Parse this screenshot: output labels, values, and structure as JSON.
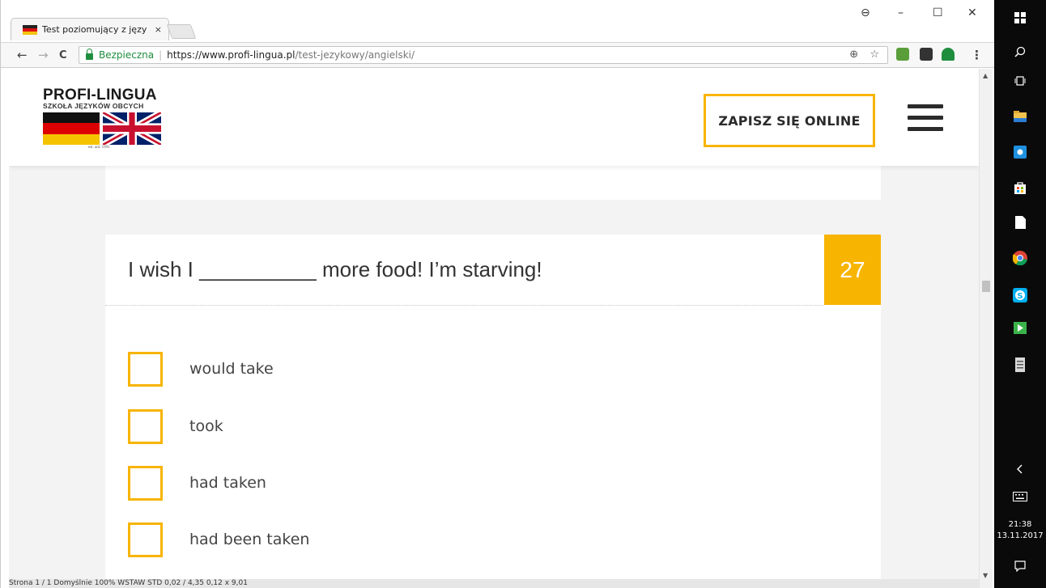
{
  "browser": {
    "tab_title": "Test poziomujący z języka",
    "tab_close": "×",
    "window_controls": {
      "account": "⊖",
      "minimize": "–",
      "maximize": "☐",
      "close": "✕"
    },
    "nav": {
      "back": "←",
      "forward": "→",
      "reload": "C"
    },
    "address": {
      "secure_label": "Bezpieczna",
      "url_scheme_host": "https://www.profi-lingua.pl",
      "url_path": "/test-jezykowy/angielski/"
    },
    "omnibox_icons": {
      "zoom": "⊕",
      "bookmark": "☆"
    },
    "menu": "⋮"
  },
  "site": {
    "logo_name": "PROFI-LINGUA",
    "logo_sub": "SZKOŁA JĘZYKÓW OBCYCH",
    "logo_est": "est. ant. 1991",
    "cta_label": "ZAPISZ SIĘ ONLINE",
    "brand_color": "#f7b400"
  },
  "question": {
    "text": "I wish I __________ more food! I’m starving!",
    "number": "27",
    "options": [
      {
        "label": "would take"
      },
      {
        "label": "took"
      },
      {
        "label": "had taken"
      },
      {
        "label": "had been taken"
      }
    ]
  },
  "statusbar": {
    "text": "Strona 1 / 1          Domyślnie                              100%  WSTAW  STD        0,02 / 4,35          0,12 x 9,01"
  },
  "taskbar": {
    "time": "21:38",
    "date": "13.11.2017",
    "icons": [
      "windows-start",
      "search",
      "task-view",
      "file-explorer",
      "store-bag",
      "store",
      "file",
      "chrome",
      "skype",
      "green-app",
      "notes"
    ]
  }
}
